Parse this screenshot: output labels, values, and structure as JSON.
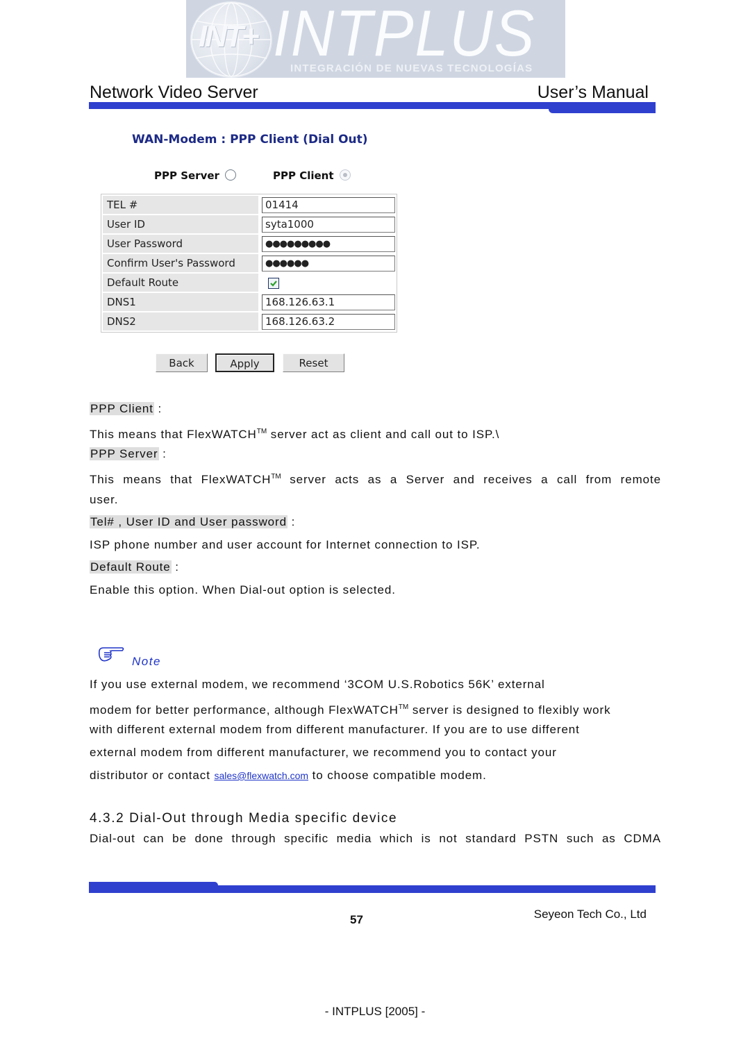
{
  "logo": {
    "emblem_text": "INT+",
    "main_text": "INTPLUS",
    "sub_text": "INTEGRACIÓN DE NUEVAS TECNOLOGÍAS"
  },
  "header": {
    "left_title": "Network Video Server",
    "right_title": "User’s Manual",
    "accent_color": "#2f40cf"
  },
  "screenshot": {
    "title": "WAN-Modem : PPP Client (Dial Out)",
    "mode_options": [
      {
        "label": "PPP Server",
        "selected": false
      },
      {
        "label": "PPP Client",
        "selected": true
      }
    ],
    "fields": [
      {
        "label": "TEL #",
        "type": "text",
        "value": "01414"
      },
      {
        "label": "User ID",
        "type": "text",
        "value": "syta1000"
      },
      {
        "label": "User Password",
        "type": "password",
        "value": "●●●●●●●●●"
      },
      {
        "label": "Confirm User's Password",
        "type": "password",
        "value": "●●●●●●"
      },
      {
        "label": "Default Route",
        "type": "checkbox",
        "checked": true
      },
      {
        "label": "DNS1",
        "type": "text",
        "value": "168.126.63.1"
      },
      {
        "label": "DNS2",
        "type": "text",
        "value": "168.126.63.2"
      }
    ],
    "buttons": {
      "back": "Back",
      "apply": "Apply",
      "reset": "Reset"
    }
  },
  "descriptions": [
    {
      "term": "PPP Client",
      "sep": " :",
      "text_before": "This means that FlexWATCH",
      "tm": "TM",
      "text_after": " server act as client and call out to ISP.\\"
    },
    {
      "term": "PPP Server",
      "sep": " :",
      "text_before": "This means that FlexWATCH",
      "tm": "TM",
      "text_after": " server acts as a Server and receives a call from remote",
      "text_line2": "user."
    },
    {
      "term": "Tel# , User ID and User password",
      "sep": " :",
      "text": "ISP phone number and user account for Internet connection to ISP."
    },
    {
      "term": "Default Route",
      "sep": " :",
      "text": "Enable this option. When Dial-out option is selected."
    }
  ],
  "note": {
    "label": "Note",
    "line1": "If you use external modem, we recommend ‘3COM U.S.Robotics 56K’ external",
    "line2_before": "modem for better performance, although FlexWATCH",
    "line2_tm": "TM",
    "line2_after": " server is designed to flexibly work",
    "line3": "with different external modem from different manufacturer. If you are to use different",
    "line4": "external modem from different manufacturer, we recommend you to contact your",
    "line5_before": "distributor or contact ",
    "link": "sales@flexwatch.com",
    "line5_after": " to choose compatible modem."
  },
  "section": {
    "heading": "4.3.2 Dial-Out through Media specific device",
    "text": "Dial-out can be done through specific media which is not standard PSTN such as CDMA"
  },
  "footer": {
    "page_number": "57",
    "company": "Seyeon Tech Co., Ltd",
    "credit": "- INTPLUS [2005] -"
  }
}
